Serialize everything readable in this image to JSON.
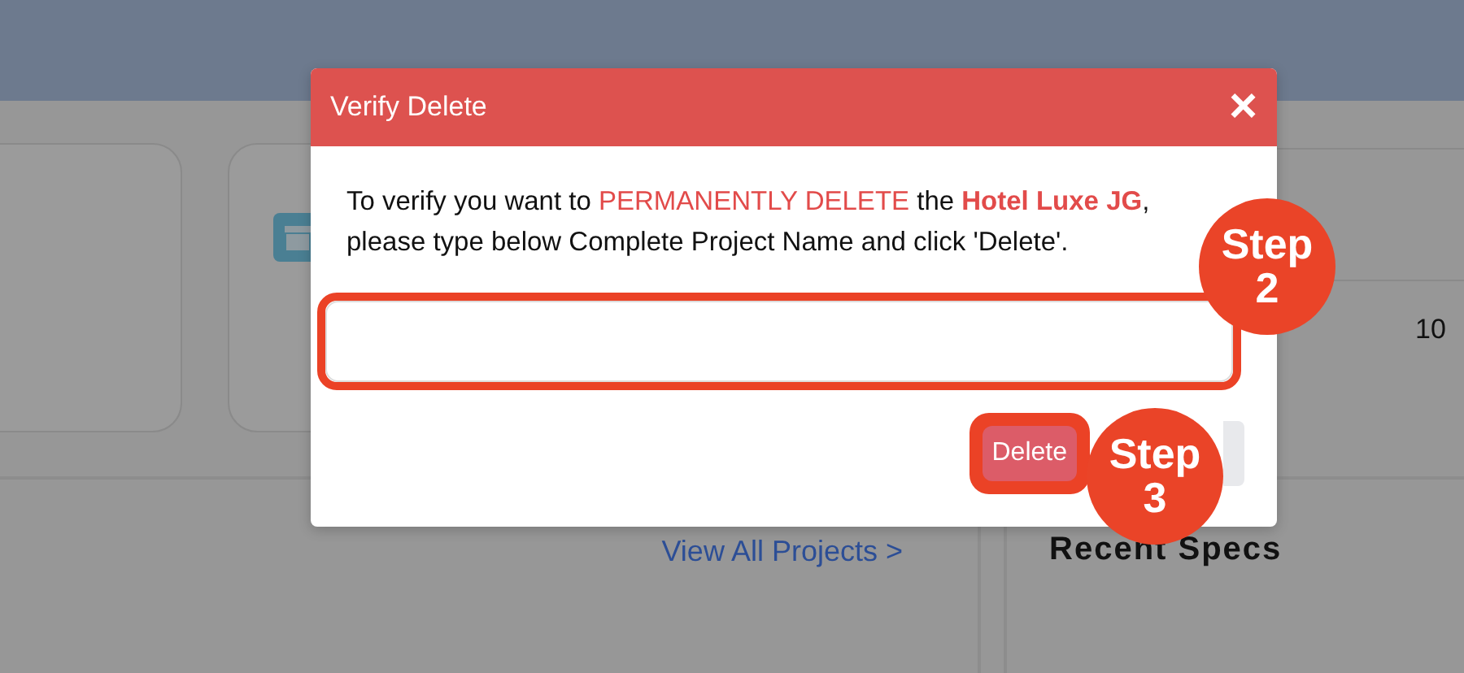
{
  "background": {
    "link": "View All Projects >",
    "heading": "Recent Specs",
    "cell": "10"
  },
  "dialog": {
    "title": "Verify Delete",
    "close": "×",
    "message": [
      {
        "kind": "plain",
        "text": "To verify you want to "
      },
      {
        "kind": "alert",
        "text": "PERMANENTLY DELETE"
      },
      {
        "kind": "plain",
        "text": " the "
      },
      {
        "kind": "name",
        "text": "Hotel Luxe JG"
      },
      {
        "kind": "plain",
        "text": ", please type below Complete Project Name and click 'Delete'."
      }
    ],
    "input": {
      "highlighted": true
    },
    "buttons": [
      {
        "kind": "danger",
        "label": "Delete",
        "highlighted": true
      },
      {
        "kind": "secondary"
      }
    ]
  },
  "steps": [
    {
      "label": "Step",
      "number": "2"
    },
    {
      "label": "Step",
      "number": "3"
    }
  ]
}
